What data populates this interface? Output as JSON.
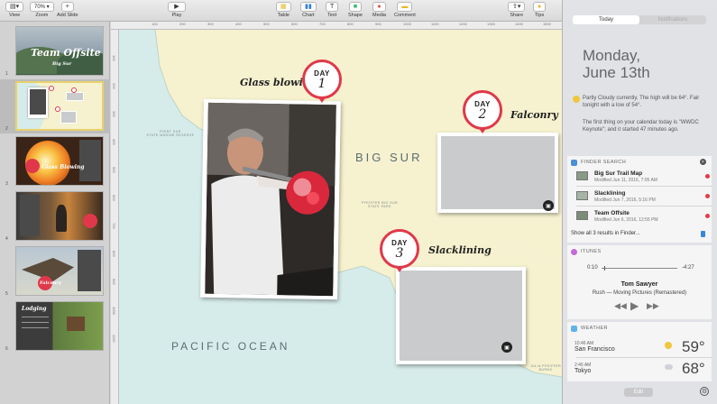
{
  "toolbar": {
    "view_label": "View",
    "zoom_value": "70%",
    "zoom_label": "Zoom",
    "add_slide_label": "Add Slide",
    "play_label": "Play",
    "table_label": "Table",
    "chart_label": "Chart",
    "text_label": "Text",
    "shape_label": "Shape",
    "media_label": "Media",
    "comment_label": "Comment",
    "share_label": "Share",
    "tips_label": "Tips"
  },
  "ruler": {
    "top_ticks": [
      "100",
      "200",
      "300",
      "400",
      "500",
      "600",
      "700",
      "800",
      "900",
      "1000",
      "1100",
      "1200",
      "1300",
      "1400",
      "1500"
    ],
    "left_ticks": [
      "100",
      "200",
      "300",
      "400",
      "500",
      "600",
      "700",
      "800",
      "900",
      "1000",
      "1100"
    ]
  },
  "navigator": {
    "slides": [
      {
        "num": "1",
        "title": "Team Offsite",
        "subtitle": "Big Sur"
      },
      {
        "num": "2"
      },
      {
        "num": "3",
        "title": "Glass Blowing"
      },
      {
        "num": "4"
      },
      {
        "num": "5",
        "title": "Falconry"
      },
      {
        "num": "6",
        "title": "Lodging"
      }
    ]
  },
  "slide": {
    "glass_blowing": "Glass blowing",
    "falconry": "Falconry",
    "slacklining": "Slacklining",
    "big_sur": "BIG SUR",
    "pacific_ocean": "PACIFIC OCEAN",
    "point_sur": "POINT SUR\nSTATE MARINE RESERVE",
    "pfeiffer": "PFEIFFER BIG SUR\nSTATE PARK",
    "julia": "JULIA PFEIFFER\nBURNS",
    "day_word": "DAY",
    "day1": "1",
    "day2": "2",
    "day3": "3"
  },
  "notification_center": {
    "tab_today": "Today",
    "tab_notifications": "Notifications",
    "day": "Monday,",
    "date": "June 13th",
    "weather_text": "Partly Cloudy currently. The high will be 64°. Fair tonight with a low of 54°.",
    "calendar_text": "The first thing on your calendar today is \"WWDC Keynote\"; and it started 47 minutes ago.",
    "finder_search": {
      "title": "FINDER SEARCH",
      "results": [
        {
          "name": "Big Sur Trail Map",
          "meta": "Modified Jun 11, 2016, 7:05 AM"
        },
        {
          "name": "Slacklining",
          "meta": "Modified Jun 7, 2016, 5:16 PM"
        },
        {
          "name": "Team Offsite",
          "meta": "Modified Jun 6, 2016, 12:55 PM"
        }
      ],
      "show_all": "Show all 3 results in Finder..."
    },
    "itunes": {
      "title": "ITUNES",
      "elapsed": "0:10",
      "remaining": "-4:27",
      "progress": 0.04,
      "song": "Tom Sawyer",
      "album": "Rush — Moving Pictures (Remastered)"
    },
    "weather": {
      "title": "WEATHER",
      "cities": [
        {
          "time": "10:46 AM",
          "city": "San Francisco",
          "temp": "59°"
        },
        {
          "time": "2:46 AM",
          "city": "Tokyo",
          "temp": "68°"
        }
      ]
    },
    "edit_label": "Edit"
  },
  "colors": {
    "accent_red": "#e0384a",
    "map_land": "#f6f1cf",
    "map_sea": "#d6ecea"
  }
}
